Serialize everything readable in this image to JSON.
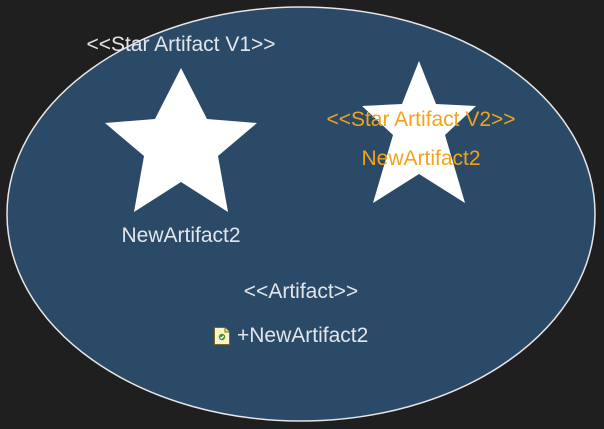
{
  "colors": {
    "background": "#1f1f1f",
    "ellipse_fill": "#2b4a68",
    "ellipse_stroke": "#e6e6e6",
    "star_fill": "#ffffff",
    "text_light": "#e2e6ea",
    "text_accent": "#f2a31b"
  },
  "container": {
    "stereotype": "<<Star Artifact V1>>"
  },
  "star_left": {
    "name": "NewArtifact2"
  },
  "star_right": {
    "stereotype": "<<Star Artifact V2>>",
    "name": "NewArtifact2"
  },
  "artifact": {
    "stereotype": "<<Artifact>>",
    "attribute_icon": "artifact-file-icon",
    "attribute": "+NewArtifact2"
  }
}
